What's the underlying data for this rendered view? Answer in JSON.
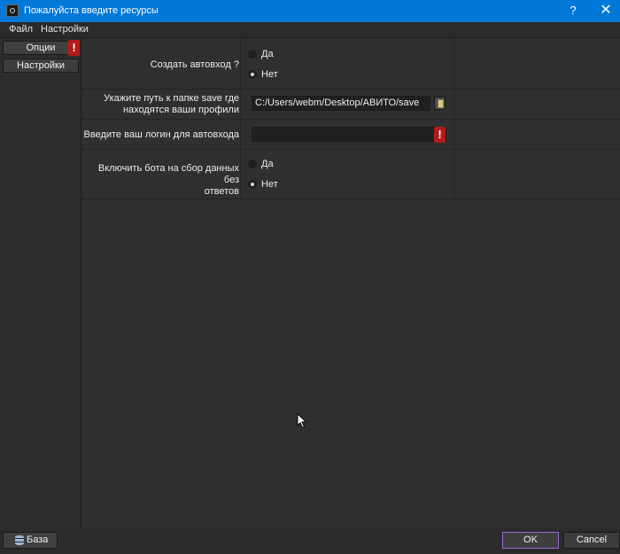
{
  "window": {
    "title": "Пожалуйста введите ресурсы",
    "help_label": "?",
    "close_label": "✕"
  },
  "menu": {
    "items": [
      {
        "label": "Файл"
      },
      {
        "label": "Настройки"
      }
    ]
  },
  "sidebar": {
    "categories": [
      {
        "label": "Опции",
        "error_badge": "!"
      },
      {
        "label": "Настройки"
      }
    ]
  },
  "form": {
    "autologin": {
      "label": "Создать автовход ?",
      "options": [
        {
          "label": "Да",
          "checked": false
        },
        {
          "label": "Нет",
          "checked": true
        }
      ]
    },
    "save_path": {
      "label_line1": "Укажите путь к папке save где",
      "label_line2": "находятся ваши профили",
      "value": "C:/Users/webm/Desktop/АВИТО/save"
    },
    "login": {
      "label": "Введите ваш логин для автовхода",
      "value": "",
      "error_badge": "!"
    },
    "bot_collect": {
      "label_line1": "Включить бота на сбор данных без",
      "label_line2": "ответов",
      "options": [
        {
          "label": "Да",
          "checked": false
        },
        {
          "label": "Нет",
          "checked": true
        }
      ]
    }
  },
  "footer": {
    "database_label": "База",
    "ok_label": "OK",
    "cancel_label": "Cancel"
  },
  "colors": {
    "titlebar": "#0078d7",
    "background": "#2d2d2d",
    "error_badge": "#b31b1b",
    "ok_border": "#9a66cc"
  }
}
